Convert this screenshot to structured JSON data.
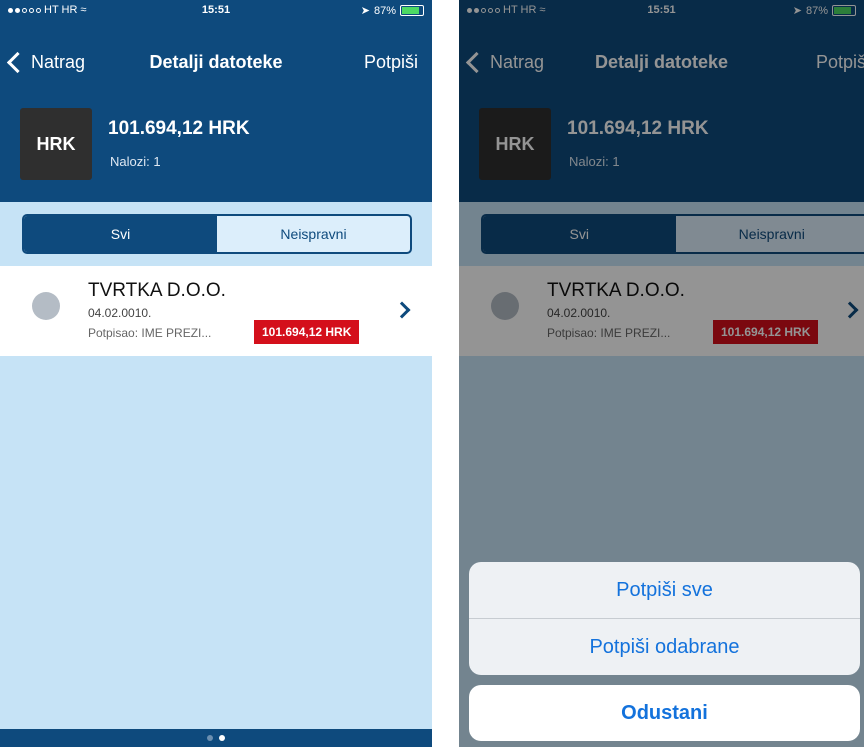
{
  "status_bar": {
    "carrier": "HT HR",
    "time": "15:51",
    "battery": "87%"
  },
  "nav": {
    "back_label": "Natrag",
    "title": "Detalji datoteke",
    "action_label": "Potpiši"
  },
  "header": {
    "currency": "HRK",
    "amount": "101.694,12 HRK",
    "orders_label": "Nalozi: 1"
  },
  "tabs": [
    {
      "label": "Svi",
      "active": true
    },
    {
      "label": "Neispravni",
      "active": false
    }
  ],
  "list": [
    {
      "title": "TVRTKA D.O.O.",
      "date": "04.02.0010.",
      "signed_by": "Potpisao: IME PREZI...",
      "amount": "101.694,12 HRK"
    }
  ],
  "action_sheet": {
    "sign_all": "Potpiši sve",
    "sign_selected": "Potpiši odabrane",
    "cancel": "Odustani"
  },
  "colors": {
    "primary": "#0e4a7d",
    "background": "#c6e3f6",
    "badge": "#d40f1b",
    "action_text": "#1372dc"
  }
}
